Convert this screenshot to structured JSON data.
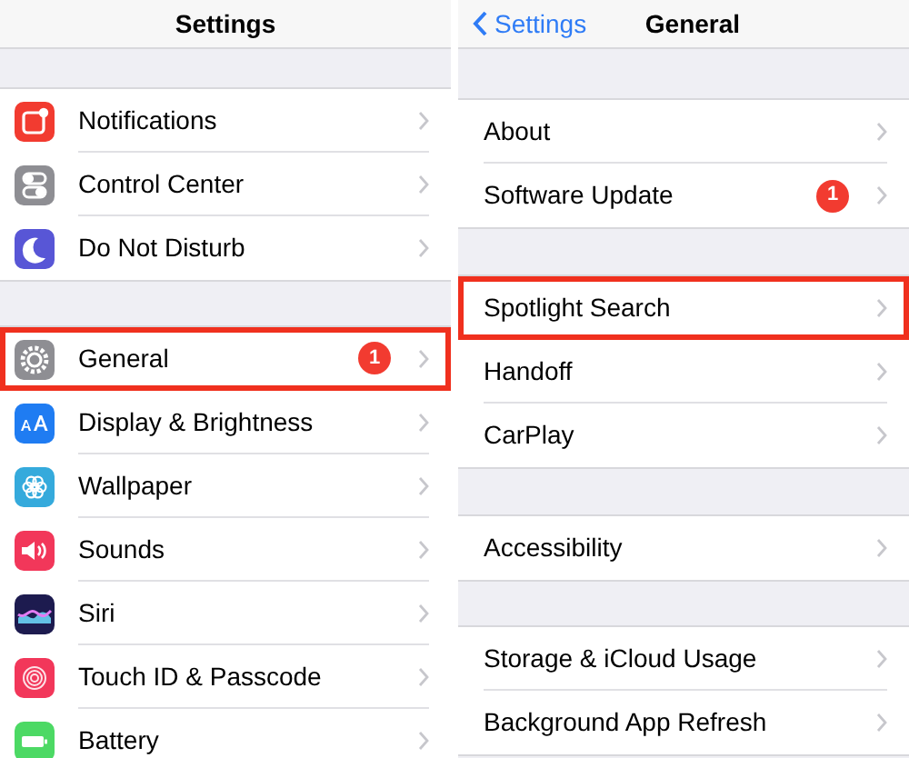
{
  "panels": [
    {
      "title": "Settings",
      "groups": [
        [
          {
            "label": "Notifications",
            "kind": "notifications",
            "highlighted": false
          },
          {
            "label": "Control Center",
            "kind": "control",
            "highlighted": false
          },
          {
            "label": "Do Not Disturb",
            "kind": "moon",
            "highlighted": false
          }
        ],
        [
          {
            "label": "General",
            "kind": "gear",
            "badge": "1",
            "highlighted": true
          },
          {
            "label": "Display & Brightness",
            "kind": "display",
            "highlighted": false
          },
          {
            "label": "Wallpaper",
            "kind": "flower",
            "highlighted": false
          },
          {
            "label": "Sounds",
            "kind": "speaker",
            "highlighted": false
          },
          {
            "label": "Siri",
            "kind": "siri",
            "highlighted": false
          },
          {
            "label": "Touch ID & Passcode",
            "kind": "fingerprint",
            "highlighted": false
          },
          {
            "label": "Battery",
            "kind": "battery",
            "highlighted": false
          }
        ]
      ]
    },
    {
      "title": "General",
      "back": "Settings",
      "groups": [
        [
          {
            "label": "About",
            "highlighted": false
          },
          {
            "label": "Software Update",
            "badge": "1",
            "highlighted": false
          }
        ],
        [
          {
            "label": "Spotlight Search",
            "highlighted": true
          },
          {
            "label": "Handoff",
            "highlighted": false
          },
          {
            "label": "CarPlay",
            "highlighted": false
          }
        ],
        [
          {
            "label": "Accessibility",
            "highlighted": false
          }
        ],
        [
          {
            "label": "Storage & iCloud Usage",
            "highlighted": false
          },
          {
            "label": "Background App Refresh",
            "highlighted": false
          }
        ]
      ]
    }
  ]
}
